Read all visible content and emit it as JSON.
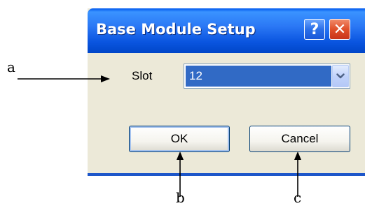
{
  "dialog": {
    "title": "Base Module Setup",
    "help_glyph": "?",
    "close_glyph": "✕"
  },
  "form": {
    "slot_label": "Slot",
    "slot_value": "12",
    "ok_label": "OK",
    "cancel_label": "Cancel"
  },
  "annotations": {
    "a": "a",
    "b": "b",
    "c": "c"
  },
  "colors": {
    "titlebar": "#0a55e0",
    "selection": "#316ac5",
    "close_button": "#e0502a",
    "dialog_face": "#ece9d8"
  }
}
